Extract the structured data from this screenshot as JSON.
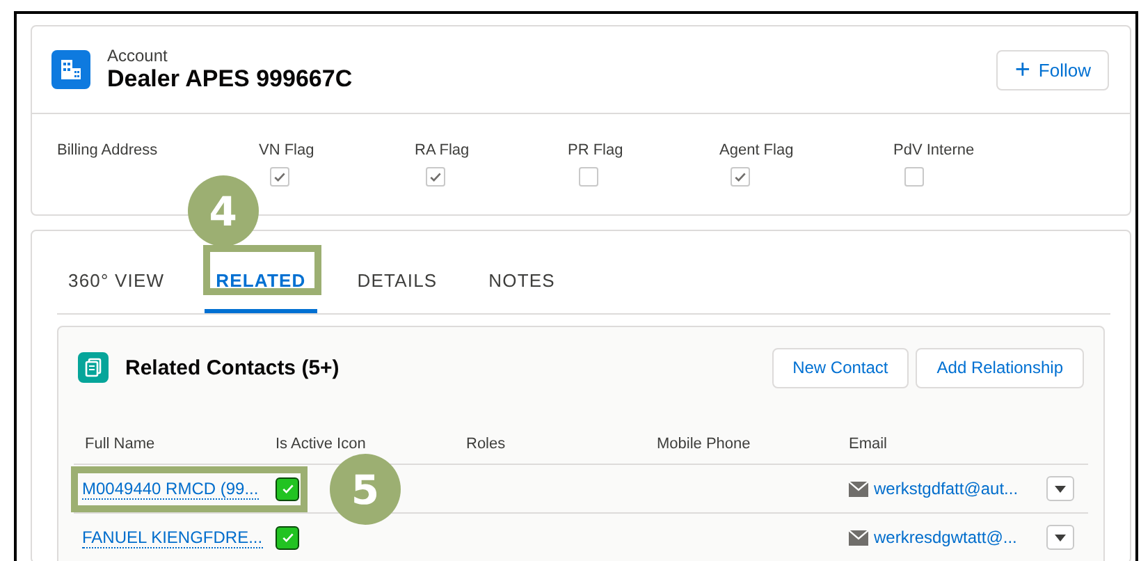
{
  "record": {
    "object_type": "Account",
    "name": "Dealer APES 999667C",
    "follow_button": {
      "icon": "+",
      "label": "Follow"
    }
  },
  "fields": [
    {
      "kind": "text",
      "label": "Billing Address"
    },
    {
      "kind": "checkbox",
      "label": "VN Flag",
      "checked": true
    },
    {
      "kind": "checkbox",
      "label": "RA Flag",
      "checked": true
    },
    {
      "kind": "checkbox",
      "label": "PR Flag",
      "checked": false
    },
    {
      "kind": "checkbox",
      "label": "Agent Flag",
      "checked": true
    },
    {
      "kind": "checkbox",
      "label": "PdV Interne",
      "checked": false
    }
  ],
  "tabs": [
    {
      "label": "360° VIEW",
      "selected": false
    },
    {
      "label": "RELATED",
      "selected": true,
      "callout": "4"
    },
    {
      "label": "DETAILS",
      "selected": false
    },
    {
      "label": "NOTES",
      "selected": false
    }
  ],
  "related_list": {
    "title": "Related Contacts (5+)",
    "buttons": [
      "New Contact",
      "Add Relationship"
    ],
    "columns": [
      "Full Name",
      "Is Active Icon",
      "Roles",
      "Mobile Phone",
      "Email"
    ],
    "rows": [
      {
        "full_name": "M0049440 RMCD (99...",
        "is_active": true,
        "email": "werkstgdfatt@aut...",
        "callout": "5"
      },
      {
        "full_name": "FANUEL KIENGFDRE...",
        "is_active": true,
        "email": "werkresdgwtatt@..."
      }
    ]
  }
}
